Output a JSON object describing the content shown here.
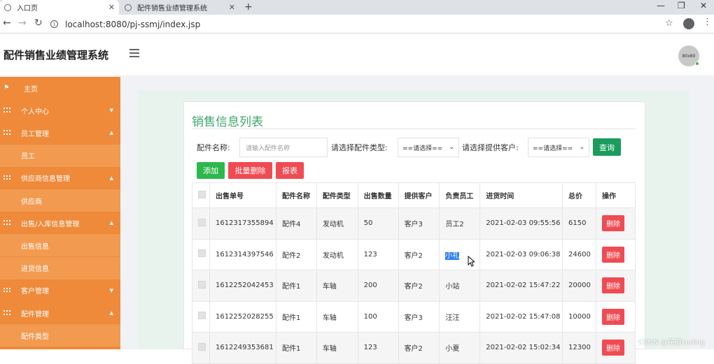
{
  "browser": {
    "tabs": [
      {
        "title": "入口页"
      },
      {
        "title": "配件销售业绩管理系统"
      }
    ],
    "url": "localhost:8080/pj-ssmj/index.jsp",
    "new_tab": "+"
  },
  "header": {
    "app_title": "配件销售业绩管理系统",
    "avatar_text": "80x80"
  },
  "sidebar": {
    "items": [
      {
        "label": "主页",
        "type": "home"
      },
      {
        "label": "个人中心",
        "type": "group",
        "caret": "▼"
      },
      {
        "label": "员工管理",
        "type": "group",
        "caret": "▲"
      },
      {
        "label": "员工",
        "type": "sub"
      },
      {
        "label": "供应商信息管理",
        "type": "group",
        "caret": "▲"
      },
      {
        "label": "供应商",
        "type": "sub"
      },
      {
        "label": "出售/入库信息管理",
        "type": "group",
        "caret": "▲"
      },
      {
        "label": "出售信息",
        "type": "sub"
      },
      {
        "label": "进货信息",
        "type": "sub"
      },
      {
        "label": "客户管理",
        "type": "group",
        "caret": "▼"
      },
      {
        "label": "配件管理",
        "type": "group",
        "caret": "▲"
      },
      {
        "label": "配件类型",
        "type": "sub"
      }
    ]
  },
  "panel": {
    "title": "销售信息列表",
    "filters": {
      "name_label": "配件名称:",
      "name_placeholder": "请输入配件名称",
      "type_label": "请选择配件类型:",
      "type_value": "==请选择==",
      "customer_label": "请选择提供客户:",
      "customer_value": "==请选择==",
      "query_label": "查询"
    },
    "actions": {
      "add": "添加",
      "batch_delete": "批量删除",
      "report": "报表"
    },
    "table": {
      "headers": [
        "出售单号",
        "配件名称",
        "配件类型",
        "出售数量",
        "提供客户",
        "负责员工",
        "进货时间",
        "总价",
        "操作"
      ],
      "rows": [
        {
          "id": "1612317355894",
          "name": "配件4",
          "type": "发动机",
          "qty": "50",
          "customer": "客户3",
          "staff": "员工2",
          "time": "2021-02-03 09:55:56",
          "total": "6150",
          "op": "删除"
        },
        {
          "id": "1612314397546",
          "name": "配件2",
          "type": "发动机",
          "qty": "123",
          "customer": "客户2",
          "staff": "小礼",
          "time": "2021-02-03 09:06:38",
          "total": "24600",
          "op": "删除"
        },
        {
          "id": "1612252042453",
          "name": "配件1",
          "type": "车轴",
          "qty": "200",
          "customer": "客户2",
          "staff": "小站",
          "time": "2021-02-02 15:47:22",
          "total": "20000",
          "op": "删除"
        },
        {
          "id": "1612252028255",
          "name": "配件1",
          "type": "车轴",
          "qty": "100",
          "customer": "客户3",
          "staff": "汪汪",
          "time": "2021-02-02 15:47:08",
          "total": "10000",
          "op": "删除"
        },
        {
          "id": "1612249353681",
          "name": "配件1",
          "type": "车轴",
          "qty": "123",
          "customer": "客户2",
          "staff": "小夏",
          "time": "2021-02-02 15:02:34",
          "total": "12300",
          "op": "删除"
        }
      ]
    }
  },
  "watermark": "CSDN @花椒coding"
}
